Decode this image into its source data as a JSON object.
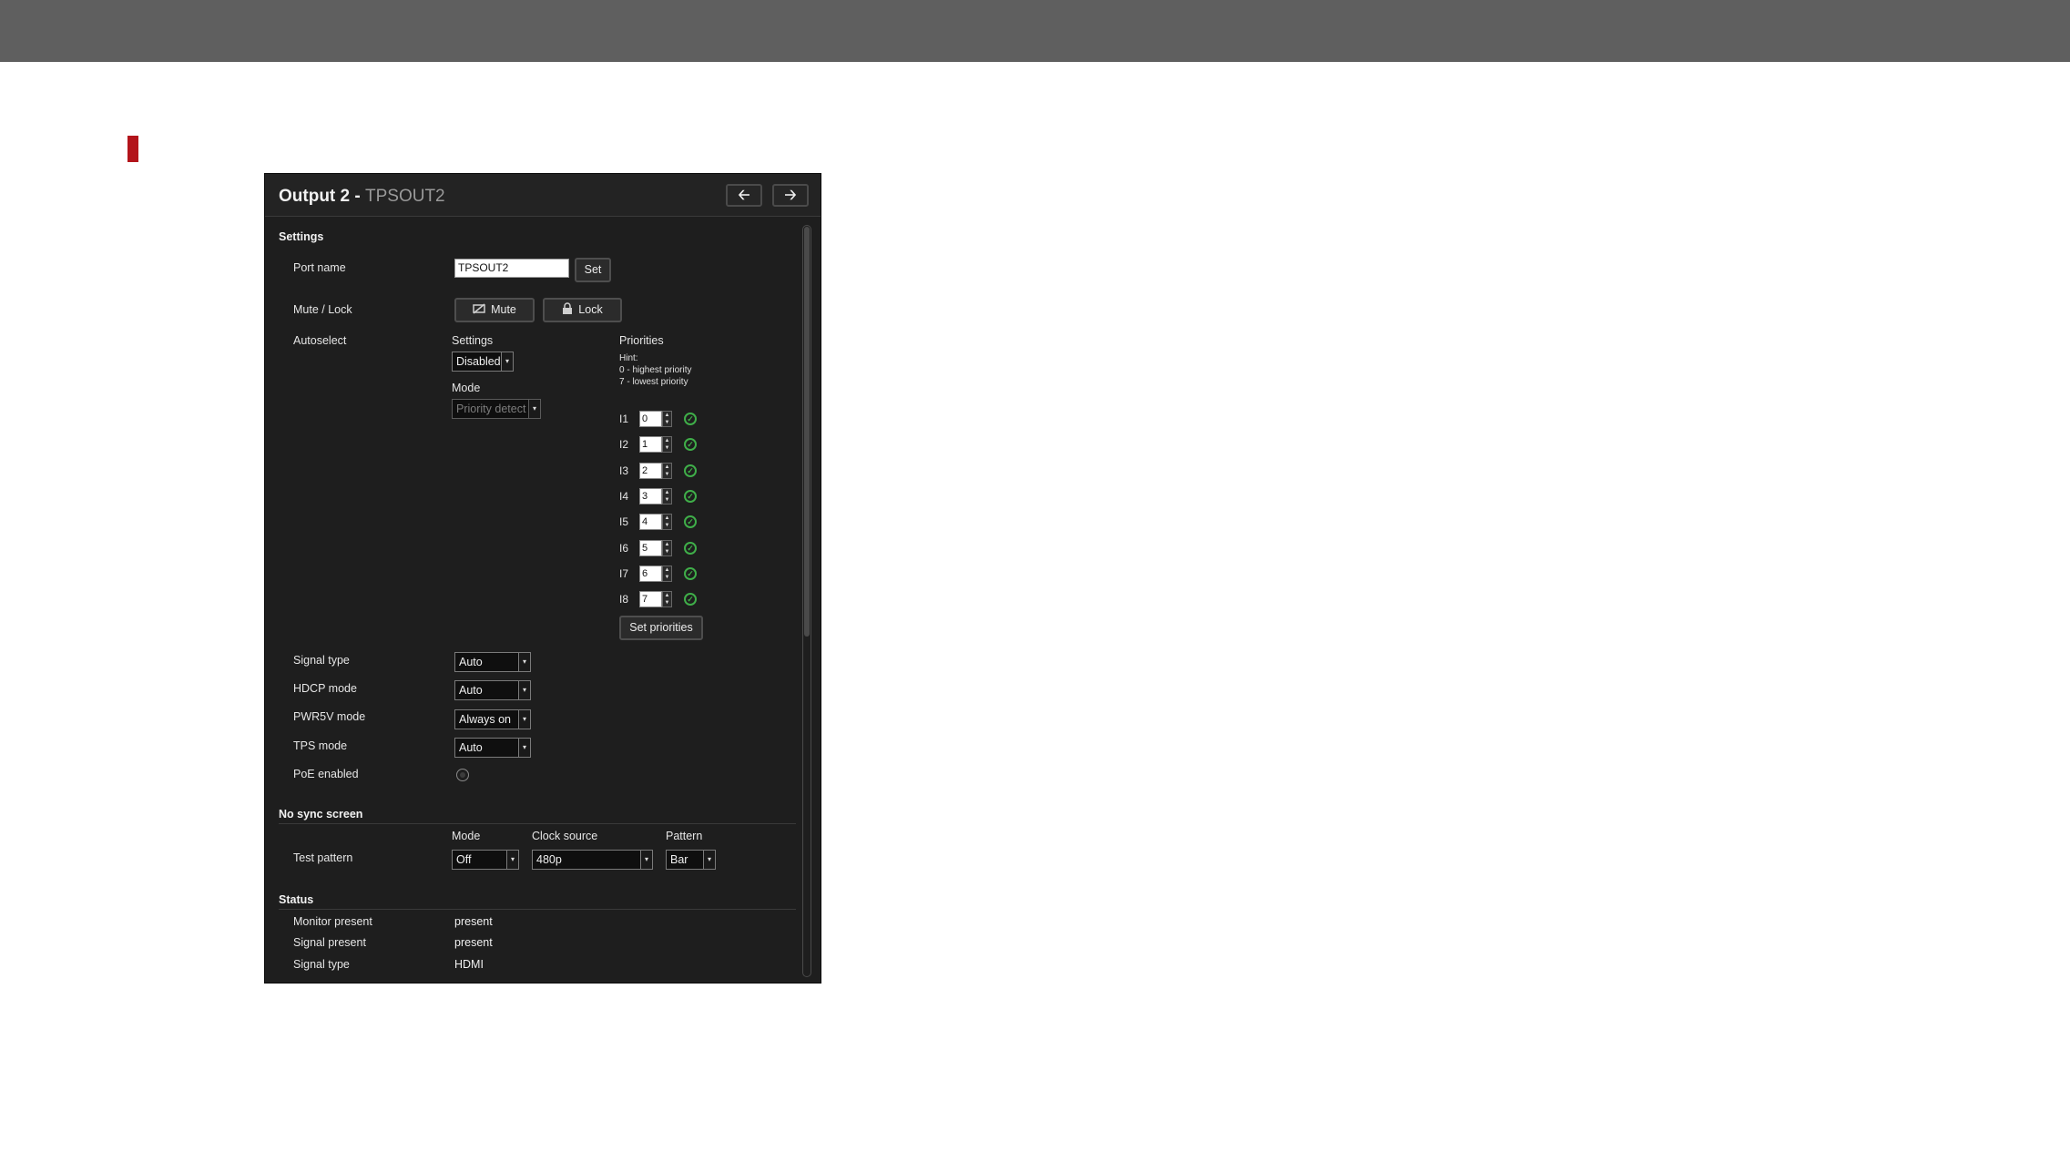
{
  "panel": {
    "title": "Output 2",
    "separator": " - ",
    "subtitle": "TPSOUT2",
    "prev_icon": "🡠",
    "next_icon": "🡢"
  },
  "settings": {
    "section_title": "Settings",
    "port_name_label": "Port name",
    "port_name_value": "TPSOUT2",
    "set_label": "Set",
    "mute_lock_label": "Mute / Lock",
    "mute_label": "Mute",
    "lock_label": "Lock",
    "autoselect_label": "Autoselect",
    "as_settings_label": "Settings",
    "as_settings_value": "Disabled",
    "as_mode_label": "Mode",
    "as_mode_value": "Priority detect",
    "priorities_label": "Priorities",
    "hint_line1": "Hint:",
    "hint_line2": "0 - highest priority",
    "hint_line3": "7 - lowest priority",
    "priorities": [
      {
        "label": "I1",
        "value": "0"
      },
      {
        "label": "I2",
        "value": "1"
      },
      {
        "label": "I3",
        "value": "2"
      },
      {
        "label": "I4",
        "value": "3"
      },
      {
        "label": "I5",
        "value": "4"
      },
      {
        "label": "I6",
        "value": "5"
      },
      {
        "label": "I7",
        "value": "6"
      },
      {
        "label": "I8",
        "value": "7"
      }
    ],
    "set_priorities_label": "Set priorities",
    "signal_type_label": "Signal type",
    "signal_type_value": "Auto",
    "hdcp_mode_label": "HDCP mode",
    "hdcp_mode_value": "Auto",
    "pwr5v_label": "PWR5V mode",
    "pwr5v_value": "Always on",
    "tps_mode_label": "TPS mode",
    "tps_mode_value": "Auto",
    "poe_label": "PoE enabled"
  },
  "no_sync": {
    "section_title": "No sync screen",
    "mode_label": "Mode",
    "clock_label": "Clock source",
    "pattern_label": "Pattern",
    "test_pattern_label": "Test pattern",
    "mode_value": "Off",
    "clock_value": "480p",
    "pattern_value": "Bar"
  },
  "status": {
    "section_title": "Status",
    "rows": [
      {
        "label": "Monitor present",
        "value": "present"
      },
      {
        "label": "Signal present",
        "value": "present"
      },
      {
        "label": "Signal type",
        "value": "HDMI"
      }
    ]
  },
  "colors": {
    "top_bar": "#5f5f5f",
    "marker": "#b3141b",
    "panel_bg": "#1e1e1e",
    "ok_green": "#3fae49"
  }
}
